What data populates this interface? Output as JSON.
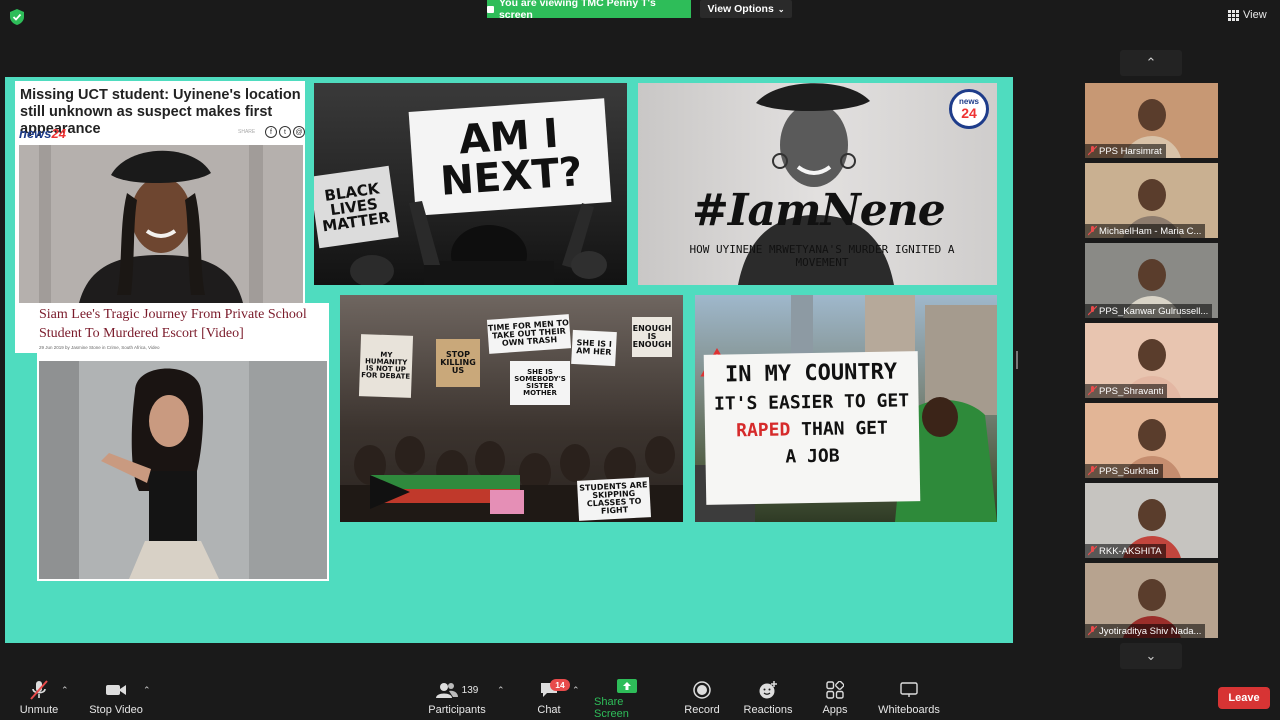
{
  "banner": {
    "viewing_text": "You are viewing TMC Penny T's screen",
    "view_options_label": "View Options",
    "view_label": "View"
  },
  "slide": {
    "article1": {
      "headline": "Missing UCT student: Uyinene's location still unknown as suspect makes first appearance",
      "logo_news": "news",
      "logo_num": "24",
      "share_label": "SHARE"
    },
    "article2": {
      "headline": "Siam Lee's Tragic Journey From Private School Student To Murdered Escort [Video]",
      "byline": "29 Jun 2019 by Jasmine Stone in Crime, South Africa, Video"
    },
    "sign_am_i_next": "AM I NEXT?",
    "sign_black_lives": "BLACK LIVES MATTER",
    "iamnene_title": "#IamNene",
    "iamnene_subtitle": "HOW UYINENE MRWETYANA'S MURDER IGNITED A MOVEMENT",
    "news24_badge_news": "news",
    "news24_badge_num": "24",
    "crowd_signs": [
      "TIME FOR MEN TO TAKE OUT THEIR OWN TRASH",
      "SHE IS I AM HER",
      "ENOUGH IS ENOUGH",
      "MY HUMANITY IS NOT UP FOR DEBATE",
      "STUDENTS ARE SKIPPING CLASSES TO FIGHT",
      "STOP KILLING US",
      "SHE IS SOMEBODY'S SISTER MOTHER"
    ],
    "country_sign_lines": [
      "IN MY COUNTRY",
      "IT'S EASIER TO GET",
      "RAPED",
      "THAN GET",
      "A JOB"
    ]
  },
  "participants": [
    {
      "name": "PPS Harsimrat",
      "bg": "#c79874",
      "shirt": "#d8c2a8"
    },
    {
      "name": "MichaelHam - Maria C...",
      "bg": "#c9b091",
      "shirt": "#8d7c6e"
    },
    {
      "name": "PPS_Kanwar Gulrussell...",
      "bg": "#8a8a86",
      "shirt": "#d9d4c7"
    },
    {
      "name": "PPS_Shravanti",
      "bg": "#e8c5b0",
      "shirt": "#e3b7a3"
    },
    {
      "name": "PPS_Surkhab",
      "bg": "#e2b596",
      "shirt": "#c58d6f"
    },
    {
      "name": "RKK-AKSHITA",
      "bg": "#c6c4c0",
      "shirt": "#c2453d"
    },
    {
      "name": "Jyotiraditya Shiv Nada...",
      "bg": "#b7a38f",
      "shirt": "#9a2e2a"
    }
  ],
  "toolbar": {
    "unmute": "Unmute",
    "stop_video": "Stop Video",
    "participants": "Participants",
    "participants_count": "139",
    "chat": "Chat",
    "chat_badge": "14",
    "share_screen": "Share Screen",
    "record": "Record",
    "reactions": "Reactions",
    "apps": "Apps",
    "whiteboards": "Whiteboards",
    "leave": "Leave"
  },
  "colors": {
    "slide_bg": "#4fdcbf",
    "banner_green": "#2ebd59",
    "leave_red": "#d73434",
    "share_green": "#2ebd59"
  }
}
